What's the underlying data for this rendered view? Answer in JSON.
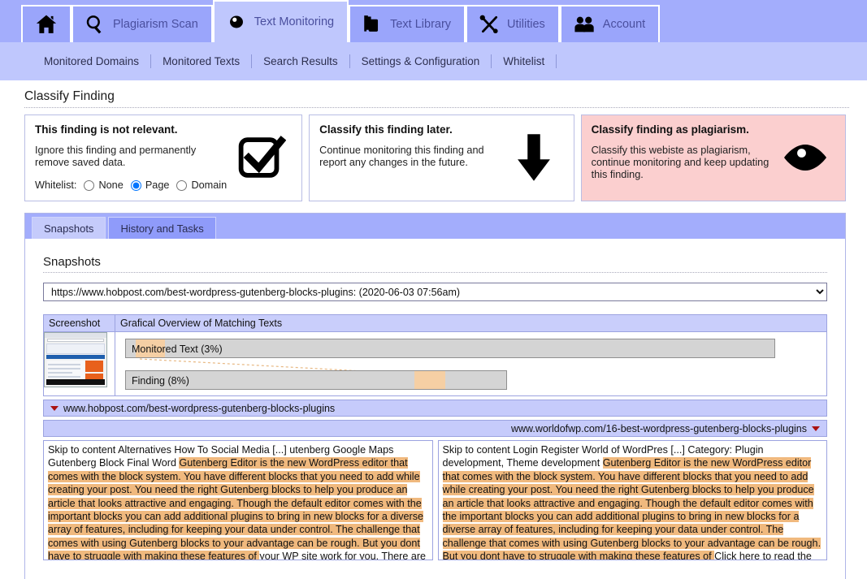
{
  "nav": {
    "tabs": [
      {
        "label": "",
        "icon": "home-icon",
        "name": "home",
        "active": false
      },
      {
        "label": "Plagiarism Scan",
        "icon": "magnifier-icon",
        "name": "plagiarism-scan",
        "active": false
      },
      {
        "label": "Text Monitoring",
        "icon": "eye-icon",
        "name": "text-monitoring",
        "active": true
      },
      {
        "label": "Text Library",
        "icon": "books-icon",
        "name": "text-library",
        "active": false
      },
      {
        "label": "Utilities",
        "icon": "tools-icon",
        "name": "utilities",
        "active": false
      },
      {
        "label": "Account",
        "icon": "people-icon",
        "name": "account",
        "active": false
      }
    ]
  },
  "subnav": {
    "items": [
      "Monitored Domains",
      "Monitored Texts",
      "Search Results",
      "Settings & Configuration",
      "Whitelist"
    ]
  },
  "classify": {
    "title": "Classify Finding",
    "panels": [
      {
        "heading": "This finding is not relevant.",
        "description": "Ignore this finding and permanently remove saved data.",
        "icon": "checkbox-checked-icon",
        "whitelist_label": "Whitelist:",
        "options": [
          "None",
          "Page",
          "Domain"
        ],
        "selected": "Page"
      },
      {
        "heading": "Classify this finding later.",
        "description": "Continue monitoring this finding and report any changes in the future.",
        "icon": "down-arrow-icon"
      },
      {
        "heading": "Classify finding as plagiarism.",
        "description": "Classify this webiste as plagiarism, continue monitoring and keep updating this finding.",
        "icon": "eye-icon"
      }
    ]
  },
  "tabs": {
    "items": [
      "Snapshots",
      "History and Tasks"
    ],
    "active": "Snapshots"
  },
  "snapshots": {
    "title": "Snapshots",
    "selected": "https://www.hobpost.com/best-wordpress-gutenberg-blocks-plugins: (2020-06-03 07:56am)",
    "options": [
      "https://www.hobpost.com/best-wordpress-gutenberg-blocks-plugins: (2020-06-03 07:56am)"
    ],
    "table": {
      "headers": [
        "Screenshot",
        "Grafical Overview of Matching Texts"
      ]
    },
    "chart_data": {
      "type": "bar",
      "title": "Grafical Overview of Matching Texts",
      "categories": [
        "Monitored Text (3%)",
        "Finding (8%)"
      ],
      "values": [
        3,
        8
      ],
      "bars": [
        {
          "label": "Monitored Text (3%)",
          "percent": 3,
          "bar_width_pct": 100,
          "match_start_pct": 1.5,
          "match_width_pct": 4.5
        },
        {
          "label": "Finding (8%)",
          "percent": 8,
          "bar_width_pct": 56,
          "match_start_pct": 76,
          "match_width_pct": 8
        }
      ],
      "connector": "match-link-line",
      "ylabel": "",
      "xlabel": ""
    },
    "urls": {
      "left": "www.hobpost.com/best-wordpress-gutenberg-blocks-plugins",
      "right": "www.worldofwp.com/16-best-wordpress-gutenberg-blocks-plugins"
    },
    "texts": {
      "left_prefix": "Skip to content Alternatives How To Social Media [...] utenberg Google Maps Gutenberg Block Final Word ",
      "left_highlight": "Gutenberg Editor is the new WordPress editor that comes with the block system. You have different blocks that you need to add while creating your post. You need the right Gutenberg blocks to help you produce an article that looks attractive and engaging. Though the default editor comes with the important blocks you can add additional plugins to bring in new blocks for a diverse array of features, including for keeping your data under control. The challenge that comes with using Gutenberg blocks to your advantage can be rough. But you dont have to struggle with making these features of ",
      "left_suffix": "your WP site work for you. There are",
      "right_prefix": "Skip to content Login Register World of WordPres [...] Category: Plugin development, Theme development ",
      "right_highlight": "Gutenberg Editor is the new WordPress editor that comes with the block system. You have different blocks that you need to add while creating your post. You need the right Gutenberg blocks to help you produce an article that looks attractive and engaging. Though the default editor comes with the important blocks you can add additional plugins to bring in new blocks for a diverse array of features, including for keeping your data under control. The challenge that comes with using Gutenberg blocks to your advantage can be rough. But you dont have to struggle with making these features of ",
      "right_suffix": "Click here to read the full article in a"
    }
  },
  "colors": {
    "topbar": "#a3adfc",
    "subnav": "#bfc7fd",
    "plagiarism_panel": "#fbcfcf",
    "highlight": "#f0b97e",
    "bar_fill": "#d4d4d4",
    "bar_match": "#f5cfa4"
  }
}
